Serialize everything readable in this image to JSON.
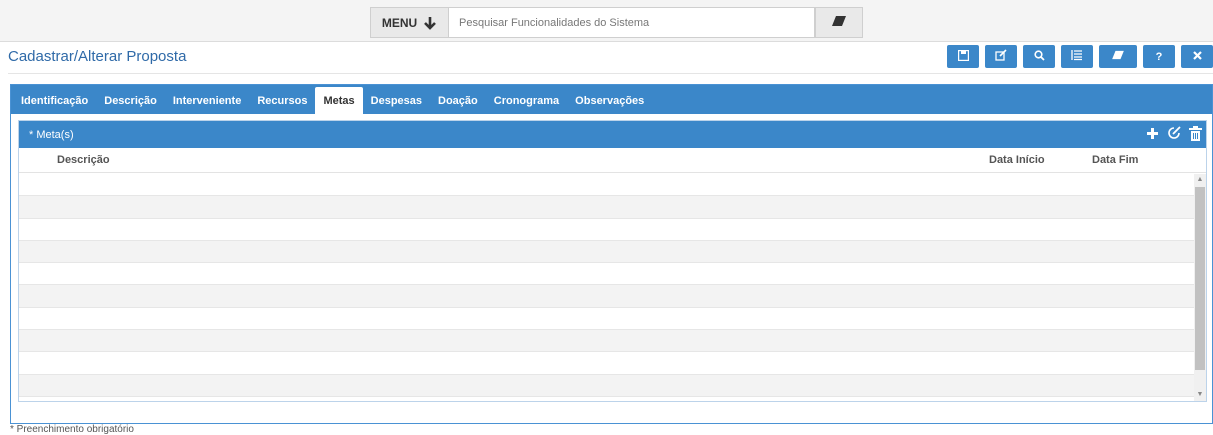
{
  "topbar": {
    "menu_label": "MENU",
    "search_placeholder": "Pesquisar Funcionalidades do Sistema"
  },
  "page": {
    "title": "Cadastrar/Alterar Proposta"
  },
  "toolbar": {
    "buttons": [
      "save-icon",
      "edit-icon",
      "search-icon",
      "list-icon",
      "eraser-icon",
      "help-icon",
      "close-icon"
    ],
    "help_label": "?"
  },
  "tabs": [
    "Identificação",
    "Descrição",
    "Interveniente",
    "Recursos",
    "Metas",
    "Despesas",
    "Doação",
    "Cronograma",
    "Observações"
  ],
  "active_tab": "Metas",
  "grid": {
    "title": "* Meta(s)",
    "columns": [
      "Descrição",
      "Data Início",
      "Data Fim"
    ],
    "row_count": 10
  },
  "footnote": "* Preenchimento obrigatório",
  "colors": {
    "accent": "#3b87c9",
    "title": "#2f6aa8"
  }
}
